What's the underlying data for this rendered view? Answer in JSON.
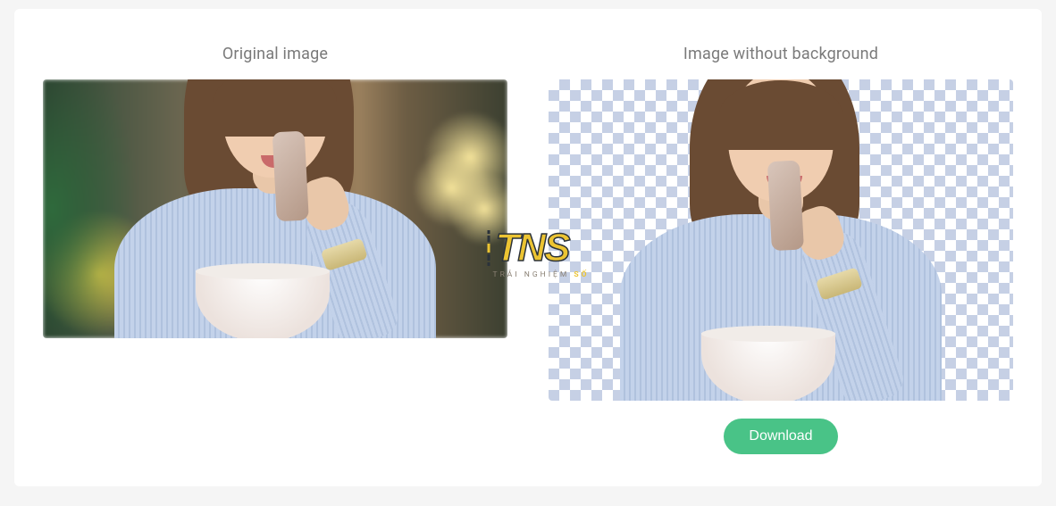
{
  "labels": {
    "original": "Original image",
    "result": "Image without background",
    "download": "Download"
  },
  "watermark": {
    "main": "TNS",
    "sub_left": "TRẢI NGHIỆM",
    "sub_right": "SỐ"
  }
}
